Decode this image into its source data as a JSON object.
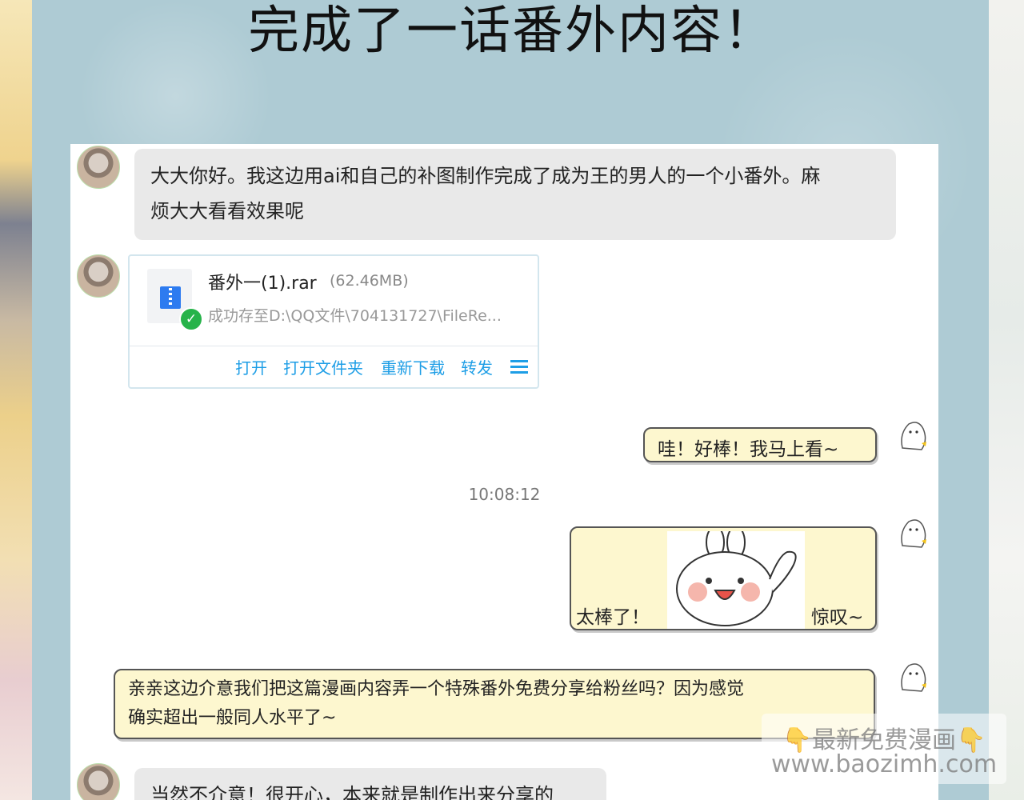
{
  "title": "完成了一话番外内容！",
  "messages": {
    "m1": {
      "text_line1": "大大你好。我这边用ai和自己的补图制作完成了成为王的男人的一个小番外。麻",
      "text_line2": "烦大大看看效果呢"
    },
    "file": {
      "name": "番外一(1).rar",
      "size": "(62.46MB)",
      "path": "成功存至D:\\QQ文件\\704131727\\FileRe...",
      "actions": [
        "打开",
        "打开文件夹",
        "重新下载",
        "转发"
      ]
    },
    "m3": {
      "text": "哇！好棒！我马上看~"
    },
    "timestamp": "10:08:12",
    "m4": {
      "left": "太棒了！",
      "right": "惊叹~"
    },
    "m5": {
      "text_line1": "亲亲这边介意我们把这篇漫画内容弄一个特殊番外免费分享给粉丝吗？因为感觉",
      "text_line2": "确实超出一般同人水平了~"
    },
    "m6": {
      "text": "当然不介意！很开心，本来就是制作出来分享的"
    }
  },
  "watermark": {
    "line1": "👇最新免费漫画👇",
    "line2": "www.baozimh.com"
  },
  "colors": {
    "link": "#1e9ee6",
    "bubble_gray": "#e9e9e9",
    "bubble_yellow": "#fdf7cf",
    "check": "#27b34a"
  }
}
